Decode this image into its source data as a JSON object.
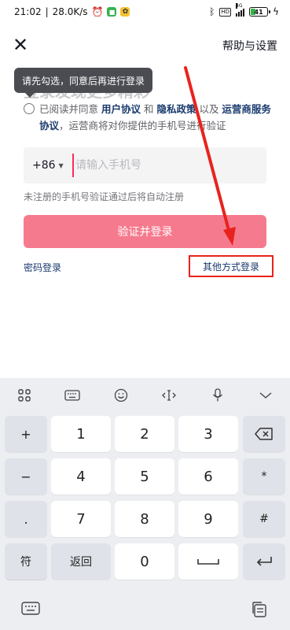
{
  "status_bar": {
    "time": "21:02",
    "speed": "28.0K/s",
    "battery": "41",
    "network_label": "4G",
    "hd_label": "HD"
  },
  "header": {
    "help_link": "帮助与设置"
  },
  "tooltip": {
    "text": "请先勾选，同意后再进行登录"
  },
  "title_behind": "登录发现更多精彩",
  "agreement": {
    "prefix": "已阅读并同意 ",
    "user_agreement": "用户协议",
    "and": " 和 ",
    "privacy_policy": "隐私政策",
    "and2": " 以及 ",
    "operator_service": "运营商服务协议",
    "suffix": "，运营商将对你提供的手机号进行验证"
  },
  "phone": {
    "country_code": "+86",
    "placeholder": "请输入手机号",
    "value": ""
  },
  "hint": "未注册的手机号验证通过后将自动注册",
  "login_button": "验证并登录",
  "password_login": "密码登录",
  "other_login": "其他方式登录",
  "keyboard": {
    "side_left": [
      "+",
      "−",
      ".",
      ","
    ],
    "digits": [
      "1",
      "2",
      "3",
      "4",
      "5",
      "6",
      "7",
      "8",
      "9",
      "0"
    ],
    "side_right_mid": [
      "*",
      "#"
    ],
    "symbol_key": "符",
    "back_key": "返回"
  },
  "colors": {
    "accent": "#fe2c55",
    "login_button": "#f67a8e",
    "link": "#1a3a6e",
    "annotation": "#e8231d"
  }
}
